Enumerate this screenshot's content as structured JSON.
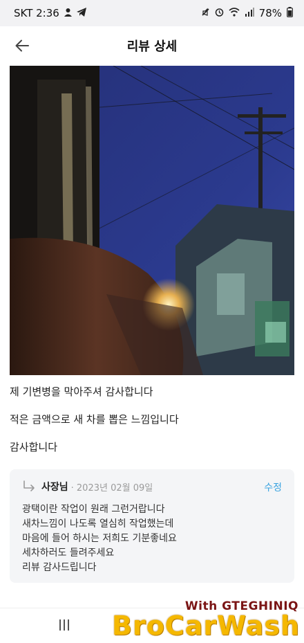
{
  "status_bar": {
    "carrier_time": "SKT 2:36",
    "battery": "78%",
    "icons": [
      "user-icon",
      "telegram-icon",
      "mute-icon",
      "alarm-icon",
      "wifi-icon",
      "signal-icon",
      "battery-icon"
    ]
  },
  "header": {
    "title": "리뷰 상세",
    "back_icon": "arrow-left-icon"
  },
  "review": {
    "photo": "night street photo",
    "lines": [
      "제 기변병을 막아주셔 감사합니다",
      "적은 금액으로 새 차를 뽑은 느낌입니다",
      "감사합니다"
    ]
  },
  "reply": {
    "author": "사장님",
    "date": "· 2023년 02월 09일",
    "edit_label": "수정",
    "lines": [
      "광택이란 작업이  원래 그런거랍니다",
      "새차느낌이 나도록 열심히 작업했는데",
      "마음에 들어 하시는 저희도 기분좋네요",
      "세차하러도 들려주세요",
      "리뷰 감사드립니다"
    ]
  },
  "watermark": {
    "sub": "With GTEGHINIQ",
    "main": "BroCarWash"
  },
  "colors": {
    "accent": "#3aa3e0",
    "watermark_main": "#f5b800",
    "watermark_sub": "#7a1414",
    "reply_bg": "#f4f5f7"
  }
}
